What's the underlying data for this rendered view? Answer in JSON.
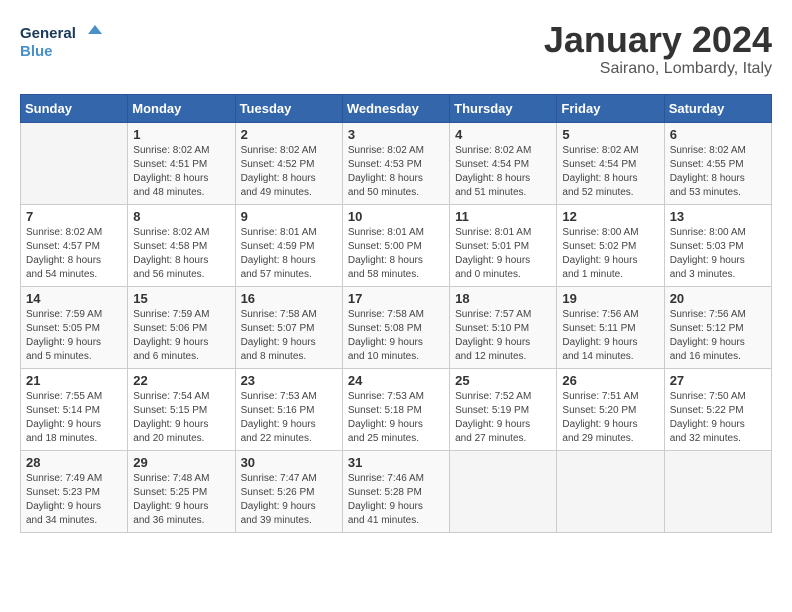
{
  "header": {
    "logo_line1": "General",
    "logo_line2": "Blue",
    "month_title": "January 2024",
    "location": "Sairano, Lombardy, Italy"
  },
  "weekdays": [
    "Sunday",
    "Monday",
    "Tuesday",
    "Wednesday",
    "Thursday",
    "Friday",
    "Saturday"
  ],
  "weeks": [
    [
      {
        "day": "",
        "info": ""
      },
      {
        "day": "1",
        "info": "Sunrise: 8:02 AM\nSunset: 4:51 PM\nDaylight: 8 hours\nand 48 minutes."
      },
      {
        "day": "2",
        "info": "Sunrise: 8:02 AM\nSunset: 4:52 PM\nDaylight: 8 hours\nand 49 minutes."
      },
      {
        "day": "3",
        "info": "Sunrise: 8:02 AM\nSunset: 4:53 PM\nDaylight: 8 hours\nand 50 minutes."
      },
      {
        "day": "4",
        "info": "Sunrise: 8:02 AM\nSunset: 4:54 PM\nDaylight: 8 hours\nand 51 minutes."
      },
      {
        "day": "5",
        "info": "Sunrise: 8:02 AM\nSunset: 4:54 PM\nDaylight: 8 hours\nand 52 minutes."
      },
      {
        "day": "6",
        "info": "Sunrise: 8:02 AM\nSunset: 4:55 PM\nDaylight: 8 hours\nand 53 minutes."
      }
    ],
    [
      {
        "day": "7",
        "info": "Sunrise: 8:02 AM\nSunset: 4:57 PM\nDaylight: 8 hours\nand 54 minutes."
      },
      {
        "day": "8",
        "info": "Sunrise: 8:02 AM\nSunset: 4:58 PM\nDaylight: 8 hours\nand 56 minutes."
      },
      {
        "day": "9",
        "info": "Sunrise: 8:01 AM\nSunset: 4:59 PM\nDaylight: 8 hours\nand 57 minutes."
      },
      {
        "day": "10",
        "info": "Sunrise: 8:01 AM\nSunset: 5:00 PM\nDaylight: 8 hours\nand 58 minutes."
      },
      {
        "day": "11",
        "info": "Sunrise: 8:01 AM\nSunset: 5:01 PM\nDaylight: 9 hours\nand 0 minutes."
      },
      {
        "day": "12",
        "info": "Sunrise: 8:00 AM\nSunset: 5:02 PM\nDaylight: 9 hours\nand 1 minute."
      },
      {
        "day": "13",
        "info": "Sunrise: 8:00 AM\nSunset: 5:03 PM\nDaylight: 9 hours\nand 3 minutes."
      }
    ],
    [
      {
        "day": "14",
        "info": "Sunrise: 7:59 AM\nSunset: 5:05 PM\nDaylight: 9 hours\nand 5 minutes."
      },
      {
        "day": "15",
        "info": "Sunrise: 7:59 AM\nSunset: 5:06 PM\nDaylight: 9 hours\nand 6 minutes."
      },
      {
        "day": "16",
        "info": "Sunrise: 7:58 AM\nSunset: 5:07 PM\nDaylight: 9 hours\nand 8 minutes."
      },
      {
        "day": "17",
        "info": "Sunrise: 7:58 AM\nSunset: 5:08 PM\nDaylight: 9 hours\nand 10 minutes."
      },
      {
        "day": "18",
        "info": "Sunrise: 7:57 AM\nSunset: 5:10 PM\nDaylight: 9 hours\nand 12 minutes."
      },
      {
        "day": "19",
        "info": "Sunrise: 7:56 AM\nSunset: 5:11 PM\nDaylight: 9 hours\nand 14 minutes."
      },
      {
        "day": "20",
        "info": "Sunrise: 7:56 AM\nSunset: 5:12 PM\nDaylight: 9 hours\nand 16 minutes."
      }
    ],
    [
      {
        "day": "21",
        "info": "Sunrise: 7:55 AM\nSunset: 5:14 PM\nDaylight: 9 hours\nand 18 minutes."
      },
      {
        "day": "22",
        "info": "Sunrise: 7:54 AM\nSunset: 5:15 PM\nDaylight: 9 hours\nand 20 minutes."
      },
      {
        "day": "23",
        "info": "Sunrise: 7:53 AM\nSunset: 5:16 PM\nDaylight: 9 hours\nand 22 minutes."
      },
      {
        "day": "24",
        "info": "Sunrise: 7:53 AM\nSunset: 5:18 PM\nDaylight: 9 hours\nand 25 minutes."
      },
      {
        "day": "25",
        "info": "Sunrise: 7:52 AM\nSunset: 5:19 PM\nDaylight: 9 hours\nand 27 minutes."
      },
      {
        "day": "26",
        "info": "Sunrise: 7:51 AM\nSunset: 5:20 PM\nDaylight: 9 hours\nand 29 minutes."
      },
      {
        "day": "27",
        "info": "Sunrise: 7:50 AM\nSunset: 5:22 PM\nDaylight: 9 hours\nand 32 minutes."
      }
    ],
    [
      {
        "day": "28",
        "info": "Sunrise: 7:49 AM\nSunset: 5:23 PM\nDaylight: 9 hours\nand 34 minutes."
      },
      {
        "day": "29",
        "info": "Sunrise: 7:48 AM\nSunset: 5:25 PM\nDaylight: 9 hours\nand 36 minutes."
      },
      {
        "day": "30",
        "info": "Sunrise: 7:47 AM\nSunset: 5:26 PM\nDaylight: 9 hours\nand 39 minutes."
      },
      {
        "day": "31",
        "info": "Sunrise: 7:46 AM\nSunset: 5:28 PM\nDaylight: 9 hours\nand 41 minutes."
      },
      {
        "day": "",
        "info": ""
      },
      {
        "day": "",
        "info": ""
      },
      {
        "day": "",
        "info": ""
      }
    ]
  ]
}
